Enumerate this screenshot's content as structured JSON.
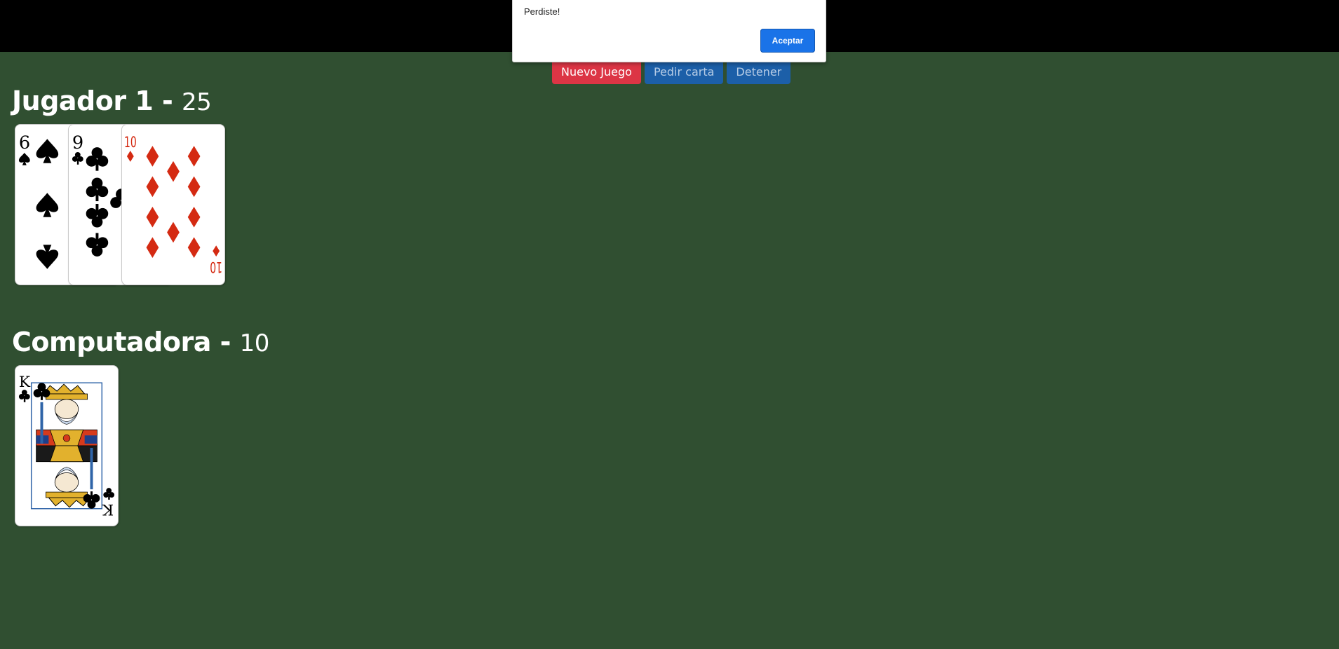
{
  "alert": {
    "message": "Perdiste!",
    "ok_label": "Aceptar"
  },
  "controls": {
    "new_game": "Nuevo Juego",
    "hit": "Pedir carta",
    "stand": "Detener"
  },
  "player": {
    "name": "Jugador 1",
    "separator": "-",
    "score": "25",
    "cards": [
      {
        "rank": "6",
        "suit": "spades",
        "color": "#000000"
      },
      {
        "rank": "9",
        "suit": "clubs",
        "color": "#000000"
      },
      {
        "rank": "10",
        "suit": "diamonds",
        "color": "#d42a12"
      }
    ]
  },
  "computer": {
    "name": "Computadora",
    "separator": "-",
    "score": "10",
    "cards": [
      {
        "rank": "K",
        "suit": "clubs",
        "color": "#000000"
      }
    ]
  },
  "colors": {
    "table": "#304f31",
    "danger": "#dc3545",
    "primary": "#1c5fa8",
    "dialog_button": "#1a73e8"
  }
}
